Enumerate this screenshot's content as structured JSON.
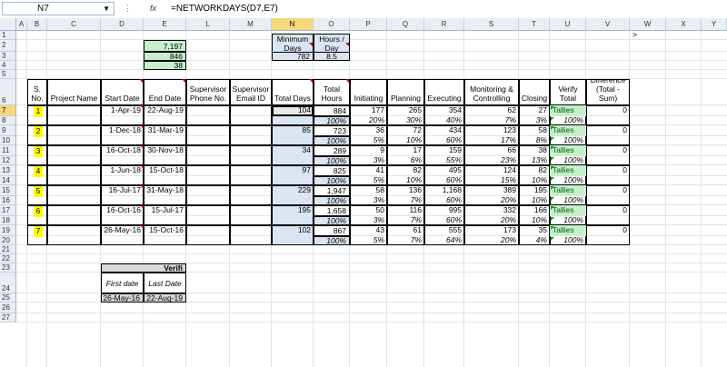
{
  "formula_bar": {
    "name_box": "N7",
    "fx": "fx",
    "formula": "=NETWORKDAYS(D7,E7)"
  },
  "columns": [
    "A",
    "B",
    "C",
    "D",
    "E",
    "L",
    "M",
    "N",
    "O",
    "P",
    "Q",
    "R",
    "S",
    "T",
    "U",
    "V",
    "W",
    "X",
    "Y"
  ],
  "rows": [
    "1",
    "2",
    "3",
    "4",
    "5",
    "6",
    "7",
    "8",
    "9",
    "10",
    "11",
    "12",
    "13",
    "14",
    "15",
    "16",
    "17",
    "18",
    "19",
    "20",
    "21",
    "22",
    "23",
    "24",
    "25",
    "26",
    "27"
  ],
  "col_glyph": ">",
  "top_values": {
    "e2": "7,197",
    "e3": "846",
    "e4": "38",
    "n_hdr": "Minimum Days",
    "o_hdr": "Hours / Day",
    "n3": "782",
    "o3": "8.5"
  },
  "headers": {
    "sno": "S. No.",
    "project": "Project Name",
    "start": "Start Date",
    "end": "End Date",
    "sup_phone": "Supervisor Phone No.",
    "sup_email": "Supervisor Email ID",
    "total_days": "Total Days",
    "total_hours": "Total Hours",
    "initiating": "Initiating",
    "planning": "Planning",
    "executing": "Executing",
    "monitoring": "Monitoring & Controlling",
    "closing": "Closing",
    "verify": "Verify Total",
    "difference": "Difference (Total - Sum)"
  },
  "records": [
    {
      "sno": "1",
      "start": "1-Apr-19",
      "end": "22-Aug-19",
      "days": "104",
      "hours": "884",
      "init": "177",
      "plan": "265",
      "exec": "354",
      "mon": "62",
      "close": "27",
      "verify": "Tallies",
      "diff": "0",
      "p_hours": "100%",
      "p_init": "20%",
      "p_plan": "30%",
      "p_exec": "40%",
      "p_mon": "7%",
      "p_close": "3%",
      "p_verify": "100%"
    },
    {
      "sno": "2",
      "start": "1-Dec-18",
      "end": "31-Mar-19",
      "days": "85",
      "hours": "723",
      "init": "36",
      "plan": "72",
      "exec": "434",
      "mon": "123",
      "close": "58",
      "verify": "Tallies",
      "diff": "0",
      "p_hours": "100%",
      "p_init": "5%",
      "p_plan": "10%",
      "p_exec": "60%",
      "p_mon": "17%",
      "p_close": "8%",
      "p_verify": "100%"
    },
    {
      "sno": "3",
      "start": "16-Oct-18",
      "end": "30-Nov-18",
      "days": "34",
      "hours": "289",
      "init": "9",
      "plan": "17",
      "exec": "159",
      "mon": "66",
      "close": "38",
      "verify": "Tallies",
      "diff": "0",
      "p_hours": "100%",
      "p_init": "3%",
      "p_plan": "6%",
      "p_exec": "55%",
      "p_mon": "23%",
      "p_close": "13%",
      "p_verify": "100%"
    },
    {
      "sno": "4",
      "start": "1-Jun-18",
      "end": "15-Oct-18",
      "days": "97",
      "hours": "825",
      "init": "41",
      "plan": "82",
      "exec": "495",
      "mon": "124",
      "close": "82",
      "verify": "Tallies",
      "diff": "0",
      "p_hours": "100%",
      "p_init": "5%",
      "p_plan": "10%",
      "p_exec": "60%",
      "p_mon": "15%",
      "p_close": "10%",
      "p_verify": "100%"
    },
    {
      "sno": "5",
      "start": "16-Jul-17",
      "end": "31-May-18",
      "days": "229",
      "hours": "1,947",
      "init": "58",
      "plan": "136",
      "exec": "1,168",
      "mon": "389",
      "close": "195",
      "verify": "Tallies",
      "diff": "0",
      "p_hours": "100%",
      "p_init": "3%",
      "p_plan": "7%",
      "p_exec": "60%",
      "p_mon": "20%",
      "p_close": "10%",
      "p_verify": "100%"
    },
    {
      "sno": "6",
      "start": "16-Oct-16",
      "end": "15-Jul-17",
      "days": "195",
      "hours": "1,658",
      "init": "50",
      "plan": "116",
      "exec": "995",
      "mon": "332",
      "close": "166",
      "verify": "Tallies",
      "diff": "0",
      "p_hours": "100%",
      "p_init": "3%",
      "p_plan": "7%",
      "p_exec": "60%",
      "p_mon": "20%",
      "p_close": "10%",
      "p_verify": "100%"
    },
    {
      "sno": "7",
      "start": "26-May-16",
      "end": "15-Oct-16",
      "days": "102",
      "hours": "867",
      "init": "43",
      "plan": "61",
      "exec": "555",
      "mon": "173",
      "close": "35",
      "verify": "Tallies",
      "diff": "0",
      "p_hours": "100%",
      "p_init": "5%",
      "p_plan": "7%",
      "p_exec": "64%",
      "p_mon": "20%",
      "p_close": "4%",
      "p_verify": "100%"
    }
  ],
  "verify_box": {
    "title": "Verifi",
    "first_label": "First date",
    "last_label": "Last Date",
    "first_value": "26-May-16",
    "last_value": "22-Aug-19"
  },
  "colors": {
    "green_fill": "#c6efce",
    "yellow_fill": "#ffff00",
    "blue_fill": "#dbe5f1",
    "selected_header": "#f5d87a"
  }
}
